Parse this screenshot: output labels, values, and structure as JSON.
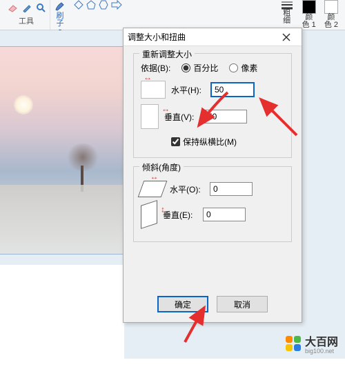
{
  "ribbon": {
    "tools_label": "工具",
    "brush_label": "刷\n子",
    "thickness_label": "粗\n细",
    "color1_label": "颜\n色 1",
    "color2_label": "颜\n色 2"
  },
  "dialog": {
    "title": "调整大小和扭曲",
    "resize": {
      "legend": "重新调整大小",
      "by_label": "依据(B):",
      "percent_label": "百分比",
      "pixel_label": "像素",
      "by_selected": "percent",
      "horizontal_label": "水平(H):",
      "horizontal_value": "50",
      "vertical_label": "垂直(V):",
      "vertical_value": "50",
      "aspect_label": "保持纵横比(M)",
      "aspect_checked": true
    },
    "skew": {
      "legend": "倾斜(角度)",
      "horizontal_label": "水平(O):",
      "horizontal_value": "0",
      "vertical_label": "垂直(E):",
      "vertical_value": "0"
    },
    "ok_label": "确定",
    "cancel_label": "取消"
  },
  "watermark": {
    "brand": "大百网",
    "url": "big100.net"
  },
  "colors": {
    "color1": "#000000",
    "color2": "#ffffff"
  }
}
